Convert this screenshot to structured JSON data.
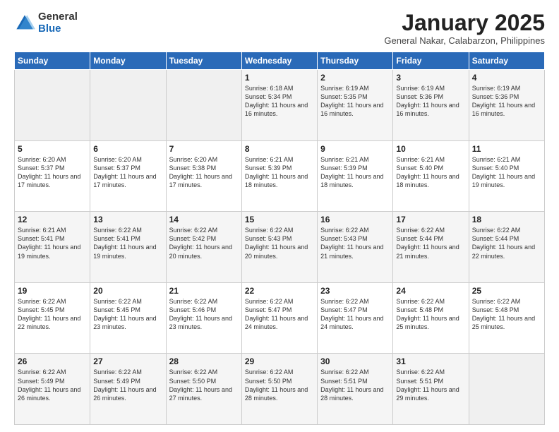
{
  "header": {
    "logo_general": "General",
    "logo_blue": "Blue",
    "title": "January 2025",
    "location": "General Nakar, Calabarzon, Philippines"
  },
  "weekdays": [
    "Sunday",
    "Monday",
    "Tuesday",
    "Wednesday",
    "Thursday",
    "Friday",
    "Saturday"
  ],
  "weeks": [
    [
      {
        "day": "",
        "info": ""
      },
      {
        "day": "",
        "info": ""
      },
      {
        "day": "",
        "info": ""
      },
      {
        "day": "1",
        "info": "Sunrise: 6:18 AM\nSunset: 5:34 PM\nDaylight: 11 hours and 16 minutes."
      },
      {
        "day": "2",
        "info": "Sunrise: 6:19 AM\nSunset: 5:35 PM\nDaylight: 11 hours and 16 minutes."
      },
      {
        "day": "3",
        "info": "Sunrise: 6:19 AM\nSunset: 5:36 PM\nDaylight: 11 hours and 16 minutes."
      },
      {
        "day": "4",
        "info": "Sunrise: 6:19 AM\nSunset: 5:36 PM\nDaylight: 11 hours and 16 minutes."
      }
    ],
    [
      {
        "day": "5",
        "info": "Sunrise: 6:20 AM\nSunset: 5:37 PM\nDaylight: 11 hours and 17 minutes."
      },
      {
        "day": "6",
        "info": "Sunrise: 6:20 AM\nSunset: 5:37 PM\nDaylight: 11 hours and 17 minutes."
      },
      {
        "day": "7",
        "info": "Sunrise: 6:20 AM\nSunset: 5:38 PM\nDaylight: 11 hours and 17 minutes."
      },
      {
        "day": "8",
        "info": "Sunrise: 6:21 AM\nSunset: 5:39 PM\nDaylight: 11 hours and 18 minutes."
      },
      {
        "day": "9",
        "info": "Sunrise: 6:21 AM\nSunset: 5:39 PM\nDaylight: 11 hours and 18 minutes."
      },
      {
        "day": "10",
        "info": "Sunrise: 6:21 AM\nSunset: 5:40 PM\nDaylight: 11 hours and 18 minutes."
      },
      {
        "day": "11",
        "info": "Sunrise: 6:21 AM\nSunset: 5:40 PM\nDaylight: 11 hours and 19 minutes."
      }
    ],
    [
      {
        "day": "12",
        "info": "Sunrise: 6:21 AM\nSunset: 5:41 PM\nDaylight: 11 hours and 19 minutes."
      },
      {
        "day": "13",
        "info": "Sunrise: 6:22 AM\nSunset: 5:41 PM\nDaylight: 11 hours and 19 minutes."
      },
      {
        "day": "14",
        "info": "Sunrise: 6:22 AM\nSunset: 5:42 PM\nDaylight: 11 hours and 20 minutes."
      },
      {
        "day": "15",
        "info": "Sunrise: 6:22 AM\nSunset: 5:43 PM\nDaylight: 11 hours and 20 minutes."
      },
      {
        "day": "16",
        "info": "Sunrise: 6:22 AM\nSunset: 5:43 PM\nDaylight: 11 hours and 21 minutes."
      },
      {
        "day": "17",
        "info": "Sunrise: 6:22 AM\nSunset: 5:44 PM\nDaylight: 11 hours and 21 minutes."
      },
      {
        "day": "18",
        "info": "Sunrise: 6:22 AM\nSunset: 5:44 PM\nDaylight: 11 hours and 22 minutes."
      }
    ],
    [
      {
        "day": "19",
        "info": "Sunrise: 6:22 AM\nSunset: 5:45 PM\nDaylight: 11 hours and 22 minutes."
      },
      {
        "day": "20",
        "info": "Sunrise: 6:22 AM\nSunset: 5:45 PM\nDaylight: 11 hours and 23 minutes."
      },
      {
        "day": "21",
        "info": "Sunrise: 6:22 AM\nSunset: 5:46 PM\nDaylight: 11 hours and 23 minutes."
      },
      {
        "day": "22",
        "info": "Sunrise: 6:22 AM\nSunset: 5:47 PM\nDaylight: 11 hours and 24 minutes."
      },
      {
        "day": "23",
        "info": "Sunrise: 6:22 AM\nSunset: 5:47 PM\nDaylight: 11 hours and 24 minutes."
      },
      {
        "day": "24",
        "info": "Sunrise: 6:22 AM\nSunset: 5:48 PM\nDaylight: 11 hours and 25 minutes."
      },
      {
        "day": "25",
        "info": "Sunrise: 6:22 AM\nSunset: 5:48 PM\nDaylight: 11 hours and 25 minutes."
      }
    ],
    [
      {
        "day": "26",
        "info": "Sunrise: 6:22 AM\nSunset: 5:49 PM\nDaylight: 11 hours and 26 minutes."
      },
      {
        "day": "27",
        "info": "Sunrise: 6:22 AM\nSunset: 5:49 PM\nDaylight: 11 hours and 26 minutes."
      },
      {
        "day": "28",
        "info": "Sunrise: 6:22 AM\nSunset: 5:50 PM\nDaylight: 11 hours and 27 minutes."
      },
      {
        "day": "29",
        "info": "Sunrise: 6:22 AM\nSunset: 5:50 PM\nDaylight: 11 hours and 28 minutes."
      },
      {
        "day": "30",
        "info": "Sunrise: 6:22 AM\nSunset: 5:51 PM\nDaylight: 11 hours and 28 minutes."
      },
      {
        "day": "31",
        "info": "Sunrise: 6:22 AM\nSunset: 5:51 PM\nDaylight: 11 hours and 29 minutes."
      },
      {
        "day": "",
        "info": ""
      }
    ]
  ]
}
